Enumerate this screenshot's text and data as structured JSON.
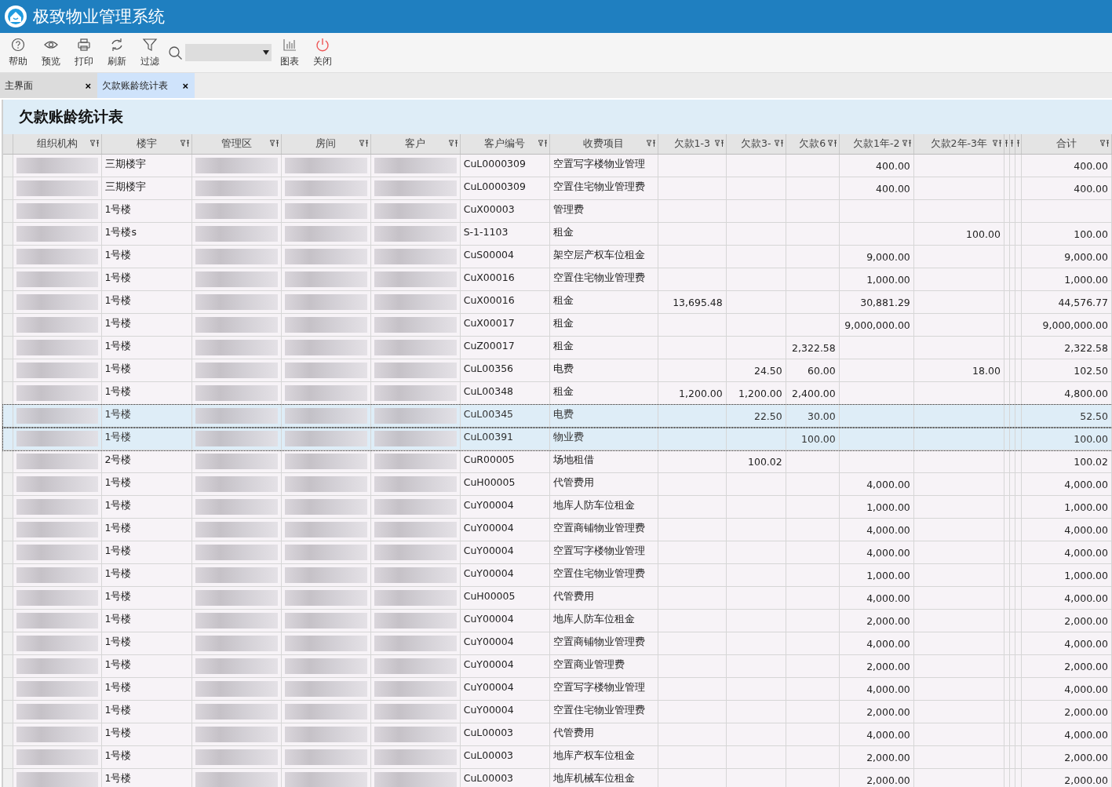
{
  "window": {
    "title": "极致物业管理系统"
  },
  "toolbar": {
    "buttons": [
      {
        "kind": "help",
        "label": "帮助"
      },
      {
        "kind": "preview",
        "label": "预览"
      },
      {
        "kind": "print",
        "label": "打印"
      },
      {
        "kind": "refresh",
        "label": "刷新"
      },
      {
        "kind": "filter",
        "label": "过滤"
      },
      {
        "kind": "search"
      },
      {
        "kind": "chart",
        "label": "图表"
      },
      {
        "kind": "close",
        "label": "关闭"
      }
    ]
  },
  "tabs": [
    {
      "label": "主界面",
      "selected": false,
      "close": "×"
    },
    {
      "label": "欠款账龄统计表",
      "selected": true,
      "close": "×"
    }
  ],
  "report": {
    "title": "欠款账龄统计表"
  },
  "table": {
    "columns": [
      {
        "label": "组织机构",
        "kind": "pixelated"
      },
      {
        "label": "楼宇",
        "kind": "text"
      },
      {
        "label": "管理区",
        "kind": "pixelated"
      },
      {
        "label": "房间",
        "kind": "pixelated"
      },
      {
        "label": "客户",
        "kind": "pixelated"
      },
      {
        "label": "客户编号",
        "kind": "text"
      },
      {
        "label": "收费项目",
        "kind": "text"
      },
      {
        "label": "欠款1-3",
        "kind": "text"
      },
      {
        "label": "欠款3-",
        "kind": "text"
      },
      {
        "label": "欠款6",
        "kind": "text"
      },
      {
        "label": "欠款1年-2",
        "kind": "text"
      },
      {
        "label": "欠款2年-3年",
        "kind": "text"
      },
      {
        "kind": "narrow"
      },
      {
        "kind": "narrow"
      },
      {
        "kind": "narrow"
      },
      {
        "label": "合计",
        "kind": "text"
      }
    ],
    "rows": [
      {
        "building": "三期楼宇",
        "code": "CuL0000309",
        "item": "空置写字楼物业管理",
        "amounts": {
          "y12": "400.00"
        },
        "total": "400.00",
        "selected": false
      },
      {
        "building": "三期楼宇",
        "code": "CuL0000309",
        "item": "空置住宅物业管理费",
        "amounts": {
          "y12": "400.00"
        },
        "total": "400.00",
        "selected": false
      },
      {
        "building": "1号楼",
        "code": "CuX00003",
        "item": "管理费",
        "selected": false
      },
      {
        "building": "1号楼s",
        "code": "S-1-1103",
        "item": "租金",
        "amounts": {
          "y23": "100.00"
        },
        "total": "100.00",
        "selected": false
      },
      {
        "building": "1号楼",
        "code": "CuS00004",
        "item": "架空层产权车位租金",
        "amounts": {
          "y12": "9,000.00"
        },
        "total": "9,000.00",
        "selected": false
      },
      {
        "building": "1号楼",
        "code": "CuX00016",
        "item": "空置住宅物业管理费",
        "amounts": {
          "y12": "1,000.00"
        },
        "total": "1,000.00",
        "selected": false
      },
      {
        "building": "1号楼",
        "code": "CuX00016",
        "item": "租金",
        "amounts": {
          "a13": "13,695.48",
          "y12": "30,881.29"
        },
        "total": "44,576.77",
        "selected": false
      },
      {
        "building": "1号楼",
        "code": "CuX00017",
        "item": "租金",
        "amounts": {
          "y12": "9,000,000.00"
        },
        "total": "9,000,000.00",
        "selected": false
      },
      {
        "building": "1号楼",
        "code": "CuZ00017",
        "item": "租金",
        "amounts": {
          "a6": "2,322.58"
        },
        "total": "2,322.58",
        "selected": false
      },
      {
        "building": "1号楼",
        "code": "CuL00356",
        "item": "电费",
        "amounts": {
          "a3": "24.50",
          "a6": "60.00",
          "y23": "18.00"
        },
        "total": "102.50",
        "selected": false
      },
      {
        "building": "1号楼",
        "code": "CuL00348",
        "item": "租金",
        "amounts": {
          "a13": "1,200.00",
          "a3": "1,200.00",
          "a6": "2,400.00"
        },
        "total": "4,800.00",
        "selected": false
      },
      {
        "building": "1号楼",
        "code": "CuL00345",
        "item": "电费",
        "amounts": {
          "a3": "22.50",
          "a6": "30.00"
        },
        "total": "52.50",
        "selected": true
      },
      {
        "building": "1号楼",
        "code": "CuL00391",
        "item": "物业费",
        "amounts": {
          "a6": "100.00"
        },
        "total": "100.00",
        "selected": true
      },
      {
        "building": "2号楼",
        "code": "CuR00005",
        "item": "场地租借",
        "amounts": {
          "a3": "100.02"
        },
        "total": "100.02",
        "selected": false
      },
      {
        "building": "1号楼",
        "code": "CuH00005",
        "item": "代管费用",
        "amounts": {
          "y12": "4,000.00"
        },
        "total": "4,000.00",
        "selected": false
      },
      {
        "building": "1号楼",
        "code": "CuY00004",
        "item": "地库人防车位租金",
        "amounts": {
          "y12": "1,000.00"
        },
        "total": "1,000.00",
        "selected": false
      },
      {
        "building": "1号楼",
        "code": "CuY00004",
        "item": "空置商铺物业管理费",
        "amounts": {
          "y12": "4,000.00"
        },
        "total": "4,000.00",
        "selected": false
      },
      {
        "building": "1号楼",
        "code": "CuY00004",
        "item": "空置写字楼物业管理",
        "amounts": {
          "y12": "4,000.00"
        },
        "total": "4,000.00",
        "selected": false
      },
      {
        "building": "1号楼",
        "code": "CuY00004",
        "item": "空置住宅物业管理费",
        "amounts": {
          "y12": "1,000.00"
        },
        "total": "1,000.00",
        "selected": false
      },
      {
        "building": "1号楼",
        "code": "CuH00005",
        "item": "代管费用",
        "amounts": {
          "y12": "4,000.00"
        },
        "total": "4,000.00",
        "selected": false
      },
      {
        "building": "1号楼",
        "code": "CuY00004",
        "item": "地库人防车位租金",
        "amounts": {
          "y12": "2,000.00"
        },
        "total": "2,000.00",
        "selected": false
      },
      {
        "building": "1号楼",
        "code": "CuY00004",
        "item": "空置商铺物业管理费",
        "amounts": {
          "y12": "4,000.00"
        },
        "total": "4,000.00",
        "selected": false
      },
      {
        "building": "1号楼",
        "code": "CuY00004",
        "item": "空置商业管理费",
        "amounts": {
          "y12": "2,000.00"
        },
        "total": "2,000.00",
        "selected": false
      },
      {
        "building": "1号楼",
        "code": "CuY00004",
        "item": "空置写字楼物业管理",
        "amounts": {
          "y12": "4,000.00"
        },
        "total": "4,000.00",
        "selected": false
      },
      {
        "building": "1号楼",
        "code": "CuY00004",
        "item": "空置住宅物业管理费",
        "amounts": {
          "y12": "2,000.00"
        },
        "total": "2,000.00",
        "selected": false
      },
      {
        "building": "1号楼",
        "code": "CuL00003",
        "item": "代管费用",
        "amounts": {
          "y12": "4,000.00"
        },
        "total": "4,000.00",
        "selected": false
      },
      {
        "building": "1号楼",
        "code": "CuL00003",
        "item": "地库产权车位租金",
        "amounts": {
          "y12": "2,000.00"
        },
        "total": "2,000.00",
        "selected": false
      },
      {
        "building": "1号楼",
        "code": "CuL00003",
        "item": "地库机械车位租金",
        "amounts": {
          "y12": "2,000.00"
        },
        "total": "2,000.00",
        "selected": false
      }
    ]
  }
}
